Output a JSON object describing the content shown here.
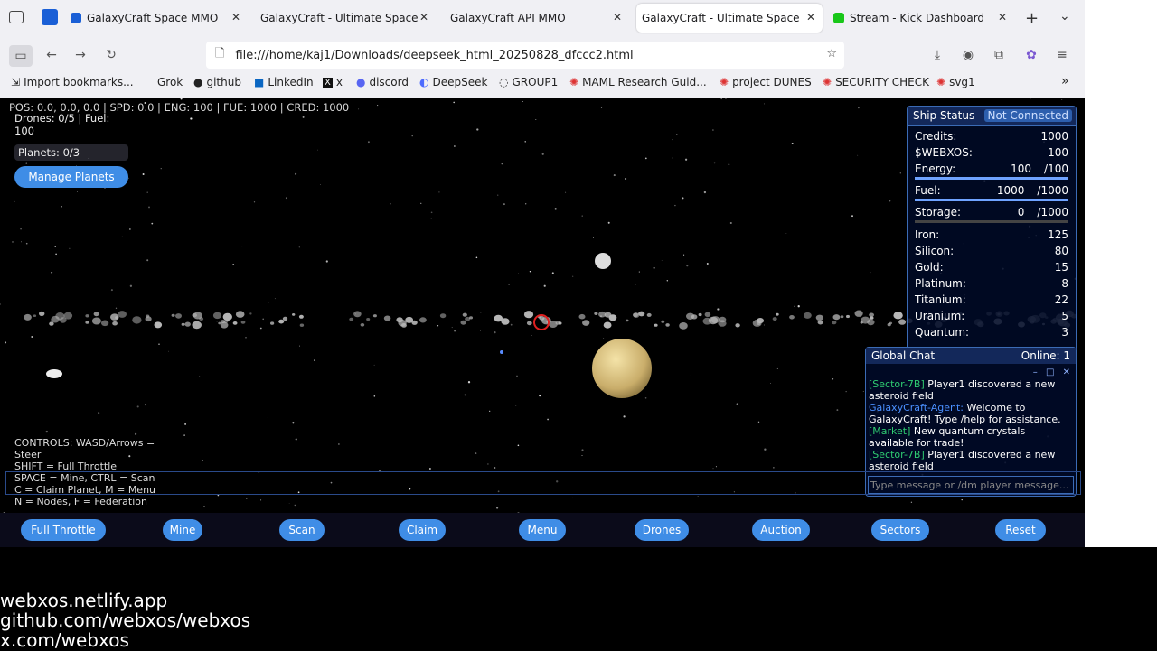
{
  "browser": {
    "tabs": [
      {
        "title": "GalaxyCraft Space MMO De",
        "favicon_color": "#1a5fd6",
        "active": false
      },
      {
        "title": "GalaxyCraft - Ultimate Space M",
        "favicon_color": "#6b5bd6",
        "active": false
      },
      {
        "title": "GalaxyCraft API MMO",
        "favicon_color": "",
        "active": false
      },
      {
        "title": "GalaxyCraft - Ultimate Space M",
        "favicon_color": "#6b5bd6",
        "active": true
      },
      {
        "title": "Stream - Kick Dashboard",
        "favicon_color": "#19c719",
        "active": false
      }
    ],
    "url": "file:///home/kaj1/Downloads/deepseek_html_20250828_dfccc2.html",
    "bookmarks": [
      {
        "label": "Import bookmarks...",
        "icon": "import-icon"
      },
      {
        "label": "Grok",
        "icon": "grok-icon"
      },
      {
        "label": "github",
        "icon": "github-icon"
      },
      {
        "label": "LinkedIn",
        "icon": "linkedin-icon"
      },
      {
        "label": "x",
        "icon": "x-icon"
      },
      {
        "label": "discord",
        "icon": "discord-icon"
      },
      {
        "label": "DeepSeek",
        "icon": "deepseek-icon"
      },
      {
        "label": "GROUP1",
        "icon": "globe-icon"
      },
      {
        "label": "MAML Research Guid...",
        "icon": "star-icon"
      },
      {
        "label": "project DUNES",
        "icon": "star-icon"
      },
      {
        "label": "SECURITY CHECK",
        "icon": "star-icon"
      },
      {
        "label": "svg1",
        "icon": "star-icon"
      }
    ]
  },
  "hud": {
    "top": "POS: 0.0, 0.0, 0.0 | SPD: 0.0 | ENG: 100 | FUE: 1000 | CRED: 1000",
    "drones_fuel": "Drones: 0/5 | Fuel: 100",
    "planets": "Planets: 0/3",
    "manage_planets": "Manage Planets",
    "controls": "CONTROLS: WASD/Arrows = Steer\nSHIFT = Full Throttle\nSPACE = Mine, CTRL = Scan\nC = Claim Planet, M = Menu\nN = Nodes, F = Federation"
  },
  "ship": {
    "title": "Ship Status",
    "connection": "Not Connected",
    "credits_label": "Credits:",
    "credits": "1000",
    "webxos_label": "$WEBXOS:",
    "webxos": "100",
    "energy_label": "Energy:",
    "energy": "100",
    "energy_max": "/100",
    "energy_level": 1.0,
    "fuel_label": "Fuel:",
    "fuel": "1000",
    "fuel_max": "/1000",
    "fuel_level": 1.0,
    "storage_label": "Storage:",
    "storage": "0",
    "storage_max": "/1000",
    "storage_level": 0.0,
    "resources": [
      {
        "name": "Iron:",
        "value": "125"
      },
      {
        "name": "Silicon:",
        "value": "80"
      },
      {
        "name": "Gold:",
        "value": "15"
      },
      {
        "name": "Platinum:",
        "value": "8"
      },
      {
        "name": "Titanium:",
        "value": "22"
      },
      {
        "name": "Uranium:",
        "value": "5"
      },
      {
        "name": "Quantum:",
        "value": "3"
      }
    ]
  },
  "chat": {
    "title": "Global Chat",
    "online": "Online: 1",
    "messages": [
      {
        "tag": "[Sector-7B]",
        "tag_color": "#2ecc71",
        "text": "Player1 discovered a new asteroid field"
      },
      {
        "tag": "GalaxyCraft-Agent:",
        "tag_color": "#4a90ff",
        "text": "Welcome to GalaxyCraft! Type /help for assistance."
      },
      {
        "tag": "[Market]",
        "tag_color": "#2ecc71",
        "text": "New quantum crystals available for trade!"
      },
      {
        "tag": "[Sector-7B]",
        "tag_color": "#2ecc71",
        "text": "Player1 discovered a new asteroid field"
      }
    ],
    "placeholder": "Type message or /dm player message..."
  },
  "buttons": [
    "Full Throttle",
    "Mine",
    "Scan",
    "Claim",
    "Menu",
    "Drones",
    "Auction",
    "Sectors",
    "Reset"
  ],
  "footer": [
    "webxos.netlify.app",
    "github.com/webxos/webxos",
    "x.com/webxos"
  ]
}
